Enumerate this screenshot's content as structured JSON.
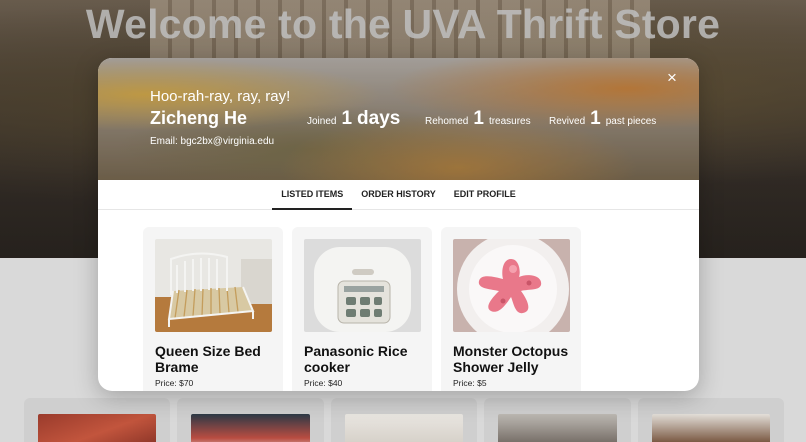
{
  "background_page": {
    "title": "Welcome to the UVA Thrift Store"
  },
  "profile": {
    "greeting": "Hoo-rah-ray, ray, ray!",
    "name": "Zicheng He",
    "email": "Email: bgc2bx@virginia.edu",
    "stats": {
      "joined_label": "Joined",
      "joined_value": "1",
      "joined_unit": "days",
      "rehomed_label": "Rehomed",
      "rehomed_value": "1",
      "rehomed_unit": "treasures",
      "revived_label": "Revived",
      "revived_value": "1",
      "revived_unit": "past pieces"
    },
    "close_icon": "×"
  },
  "tabs": [
    {
      "label": "LISTED ITEMS",
      "active": true
    },
    {
      "label": "ORDER HISTORY",
      "active": false
    },
    {
      "label": "EDIT PROFILE",
      "active": false
    }
  ],
  "items": [
    {
      "title": "Queen Size Bed Brame",
      "price": "Price: $70",
      "icon": "bed-frame-photo"
    },
    {
      "title": "Panasonic Rice cooker",
      "price": "Price: $40",
      "icon": "rice-cooker-photo"
    },
    {
      "title": "Monster Octopus Shower Jelly",
      "price": "Price: $5",
      "icon": "shower-jelly-photo"
    }
  ],
  "colors": {
    "tab_active_border": "#222222",
    "card_background": "#f5f5f5"
  }
}
